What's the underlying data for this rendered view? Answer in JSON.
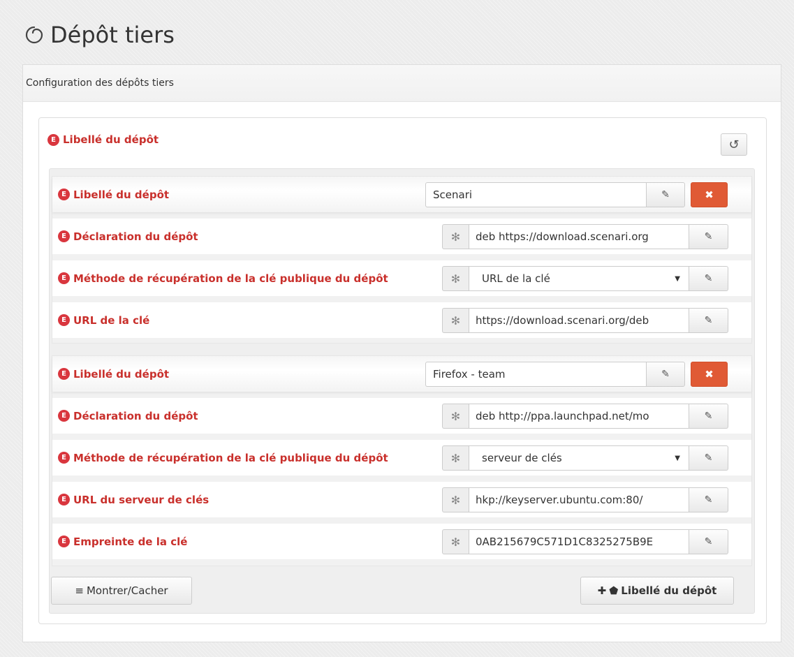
{
  "page": {
    "title": "Dépôt tiers"
  },
  "panel": {
    "heading": "Configuration des dépôts tiers"
  },
  "outer": {
    "label": "Libellé du dépôt",
    "badge": "E",
    "reset_icon": "undo-icon"
  },
  "icons": {
    "edit": "pencil-square-icon",
    "delete": "times-icon",
    "required": "asterisk-icon"
  },
  "entries": [
    {
      "label": "Libellé du dépôt",
      "name_value": "Scenari",
      "fields": [
        {
          "label": "Déclaration du dépôt",
          "value": "deb https://download.scenari.org"
        },
        {
          "label": "Méthode de récupération de la clé publique du dépôt",
          "value": "URL de la clé",
          "select": true
        },
        {
          "label": "URL de la clé",
          "value": "https://download.scenari.org/deb"
        }
      ]
    },
    {
      "label": "Libellé du dépôt",
      "name_value": "Firefox - team",
      "fields": [
        {
          "label": "Déclaration du dépôt",
          "value": "deb http://ppa.launchpad.net/mo"
        },
        {
          "label": "Méthode de récupération de la clé publique du dépôt",
          "value": "serveur de clés",
          "select": true
        },
        {
          "label": "URL du serveur de clés",
          "value": "hkp://keyserver.ubuntu.com:80/"
        },
        {
          "label": "Empreinte de la clé",
          "value": "0AB215679C571D1C8325275B9E"
        }
      ]
    }
  ],
  "footer": {
    "toggle_label": "Montrer/Cacher",
    "add_label": "Libellé du dépôt"
  },
  "colors": {
    "label_red": "#c9302c",
    "badge_red": "#d9363e",
    "delete_orange": "#e05a35"
  }
}
